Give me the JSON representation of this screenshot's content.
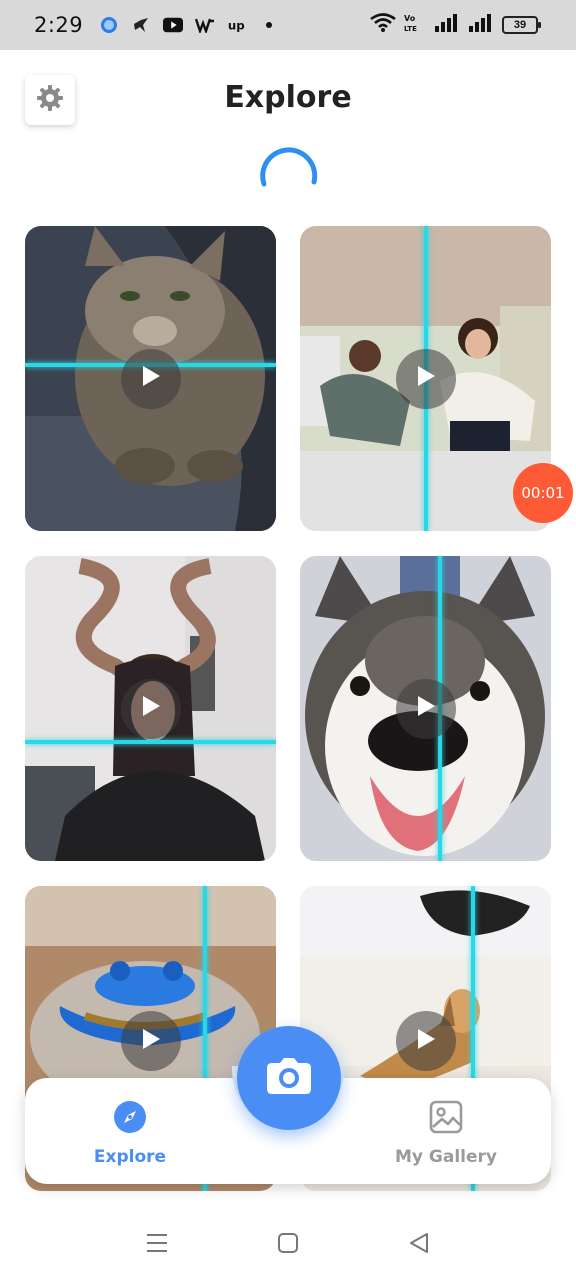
{
  "status_bar": {
    "time": "2:29",
    "battery": "39"
  },
  "header": {
    "title": "Explore"
  },
  "videos": [
    {
      "id": "cat"
    },
    {
      "id": "two-girls",
      "timer": "00:01"
    },
    {
      "id": "girl-horns"
    },
    {
      "id": "husky"
    },
    {
      "id": "spinner-toy"
    },
    {
      "id": "dog"
    }
  ],
  "timer_badge": "00:01",
  "bottom_nav": {
    "explore_label": "Explore",
    "gallery_label": "My Gallery",
    "active": "explore"
  },
  "colors": {
    "accent": "#4a8ef5",
    "scan_line": "#29d7e6",
    "timer": "#ff5a36",
    "inactive": "#999999"
  }
}
